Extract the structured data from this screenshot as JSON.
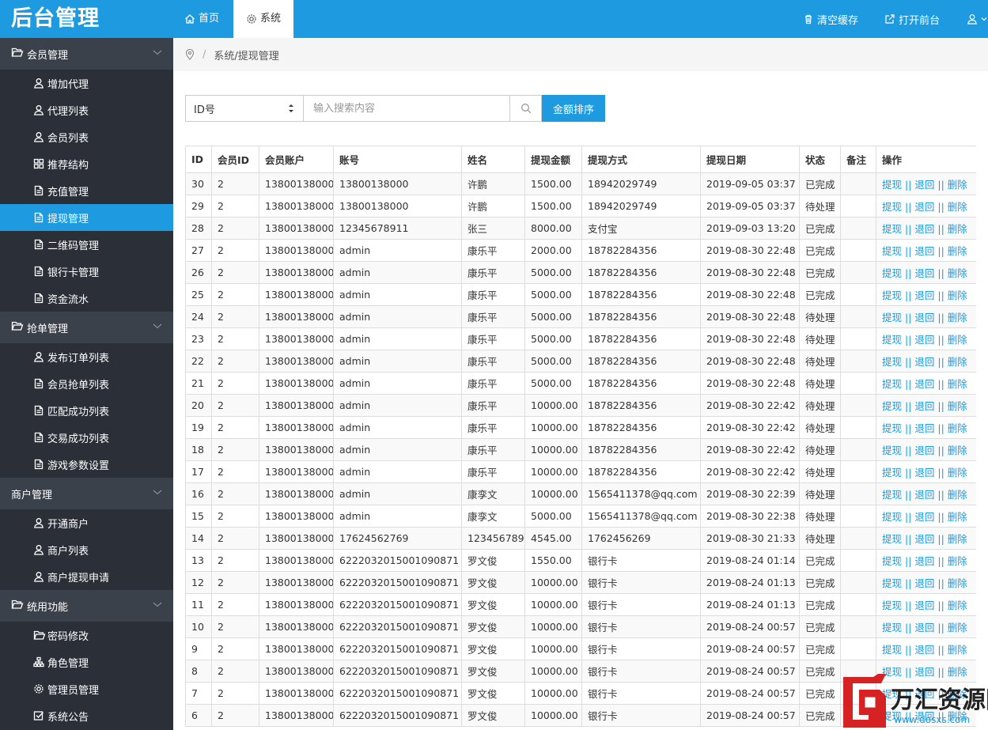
{
  "app": {
    "title": "后台管理"
  },
  "sidebar": {
    "groups": [
      {
        "label": "会员管理",
        "icon": "folder-open-icon",
        "items": [
          {
            "label": "增加代理",
            "icon": "user-icon"
          },
          {
            "label": "代理列表",
            "icon": "user-icon"
          },
          {
            "label": "会员列表",
            "icon": "user-icon"
          },
          {
            "label": "推荐结构",
            "icon": "grid-icon"
          },
          {
            "label": "充值管理",
            "icon": "document-icon"
          },
          {
            "label": "提现管理",
            "icon": "document-icon",
            "active": true
          },
          {
            "label": "二维码管理",
            "icon": "document-icon"
          },
          {
            "label": "银行卡管理",
            "icon": "document-icon"
          },
          {
            "label": "资金流水",
            "icon": "document-icon"
          }
        ]
      },
      {
        "label": "抢单管理",
        "icon": "folder-open-icon",
        "items": [
          {
            "label": "发布订单列表",
            "icon": "user-icon"
          },
          {
            "label": "会员抢单列表",
            "icon": "document-icon"
          },
          {
            "label": "匹配成功列表",
            "icon": "document-icon"
          },
          {
            "label": "交易成功列表",
            "icon": "document-icon"
          },
          {
            "label": "游戏参数设置",
            "icon": "document-icon"
          }
        ]
      },
      {
        "label": "商户管理",
        "icon": "",
        "items": [
          {
            "label": "开通商户",
            "icon": "user-icon"
          },
          {
            "label": "商户列表",
            "icon": "user-icon"
          },
          {
            "label": "商户提现申请",
            "icon": "user-icon"
          }
        ]
      },
      {
        "label": "统用功能",
        "icon": "folder-open-icon",
        "items": [
          {
            "label": "密码修改",
            "icon": "folder-open-icon"
          },
          {
            "label": "角色管理",
            "icon": "sitemap-icon"
          },
          {
            "label": "管理员管理",
            "icon": "gear-icon"
          },
          {
            "label": "系统公告",
            "icon": "check-square-icon"
          }
        ]
      }
    ]
  },
  "topbar": {
    "tabs": [
      {
        "label": "首页",
        "icon": "home-icon"
      },
      {
        "label": "系统",
        "icon": "gear-icon"
      }
    ],
    "clear_cache": "清空缓存",
    "open_front": "打开前台",
    "accent": "#1e9be0"
  },
  "breadcrumb": {
    "path": "系统/提现管理"
  },
  "search": {
    "select_value": "ID号",
    "placeholder": "输入搜索内容",
    "sort_button": "金额排序"
  },
  "table": {
    "columns": [
      "ID",
      "会员ID",
      "会员账户",
      "账号",
      "姓名",
      "提现金额",
      "提现方式",
      "提现日期",
      "状态",
      "备注",
      "操作"
    ],
    "ops": {
      "withdraw": "提现",
      "sep": " || ",
      "return": "退回",
      "delete": "删除"
    },
    "rows": [
      [
        "30",
        "2",
        "13800138000",
        "13800138000",
        "许鹏",
        "1500.00",
        "18942029749",
        "2019-09-05 03:37",
        "已完成",
        ""
      ],
      [
        "29",
        "2",
        "13800138000",
        "13800138000",
        "许鹏",
        "1500.00",
        "18942029749",
        "2019-09-05 03:37",
        "待处理",
        ""
      ],
      [
        "28",
        "2",
        "13800138000",
        "12345678911",
        "张三",
        "8000.00",
        "支付宝",
        "2019-09-03 13:20",
        "已完成",
        ""
      ],
      [
        "27",
        "2",
        "13800138000",
        "admin",
        "康乐平",
        "2000.00",
        "18782284356",
        "2019-08-30 22:48",
        "已完成",
        ""
      ],
      [
        "26",
        "2",
        "13800138000",
        "admin",
        "康乐平",
        "5000.00",
        "18782284356",
        "2019-08-30 22:48",
        "已完成",
        ""
      ],
      [
        "25",
        "2",
        "13800138000",
        "admin",
        "康乐平",
        "5000.00",
        "18782284356",
        "2019-08-30 22:48",
        "已完成",
        ""
      ],
      [
        "24",
        "2",
        "13800138000",
        "admin",
        "康乐平",
        "5000.00",
        "18782284356",
        "2019-08-30 22:48",
        "待处理",
        ""
      ],
      [
        "23",
        "2",
        "13800138000",
        "admin",
        "康乐平",
        "5000.00",
        "18782284356",
        "2019-08-30 22:48",
        "待处理",
        ""
      ],
      [
        "22",
        "2",
        "13800138000",
        "admin",
        "康乐平",
        "5000.00",
        "18782284356",
        "2019-08-30 22:48",
        "待处理",
        ""
      ],
      [
        "21",
        "2",
        "13800138000",
        "admin",
        "康乐平",
        "5000.00",
        "18782284356",
        "2019-08-30 22:48",
        "待处理",
        ""
      ],
      [
        "20",
        "2",
        "13800138000",
        "admin",
        "康乐平",
        "10000.00",
        "18782284356",
        "2019-08-30 22:42",
        "待处理",
        ""
      ],
      [
        "19",
        "2",
        "13800138000",
        "admin",
        "康乐平",
        "10000.00",
        "18782284356",
        "2019-08-30 22:42",
        "待处理",
        ""
      ],
      [
        "18",
        "2",
        "13800138000",
        "admin",
        "康乐平",
        "10000.00",
        "18782284356",
        "2019-08-30 22:42",
        "待处理",
        ""
      ],
      [
        "17",
        "2",
        "13800138000",
        "admin",
        "康乐平",
        "10000.00",
        "18782284356",
        "2019-08-30 22:42",
        "待处理",
        ""
      ],
      [
        "16",
        "2",
        "13800138000",
        "admin",
        "康孪文",
        "10000.00",
        "1565411378@qq.com",
        "2019-08-30 22:39",
        "待处理",
        ""
      ],
      [
        "15",
        "2",
        "13800138000",
        "admin",
        "康孪文",
        "5000.00",
        "1565411378@qq.com",
        "2019-08-30 22:38",
        "待处理",
        ""
      ],
      [
        "14",
        "2",
        "13800138000",
        "17624562769",
        "123456789",
        "4545.00",
        "1762456269",
        "2019-08-30 21:33",
        "待处理",
        ""
      ],
      [
        "13",
        "2",
        "13800138000",
        "6222032015001090871",
        "罗文俊",
        "1550.00",
        "银行卡",
        "2019-08-24 01:14",
        "已完成",
        ""
      ],
      [
        "12",
        "2",
        "13800138000",
        "6222032015001090871",
        "罗文俊",
        "10000.00",
        "银行卡",
        "2019-08-24 01:13",
        "已完成",
        ""
      ],
      [
        "11",
        "2",
        "13800138000",
        "6222032015001090871",
        "罗文俊",
        "10000.00",
        "银行卡",
        "2019-08-24 01:13",
        "已完成",
        ""
      ],
      [
        "10",
        "2",
        "13800138000",
        "6222032015001090871",
        "罗文俊",
        "10000.00",
        "银行卡",
        "2019-08-24 00:57",
        "已完成",
        ""
      ],
      [
        "9",
        "2",
        "13800138000",
        "6222032015001090871",
        "罗文俊",
        "10000.00",
        "银行卡",
        "2019-08-24 00:57",
        "已完成",
        ""
      ],
      [
        "8",
        "2",
        "13800138000",
        "6222032015001090871",
        "罗文俊",
        "10000.00",
        "银行卡",
        "2019-08-24 00:57",
        "已完成",
        ""
      ],
      [
        "7",
        "2",
        "13800138000",
        "6222032015001090871",
        "罗文俊",
        "10000.00",
        "银行卡",
        "2019-08-24 00:57",
        "已完成",
        ""
      ],
      [
        "6",
        "2",
        "13800138000",
        "6222032015001090871",
        "罗文俊",
        "10000.00",
        "银行卡",
        "2019-08-24 00:57",
        "已完成",
        ""
      ]
    ]
  },
  "watermark": {
    "title": "万汇资源网",
    "url": "www.dosxs.com",
    "accent": "#d62222"
  }
}
